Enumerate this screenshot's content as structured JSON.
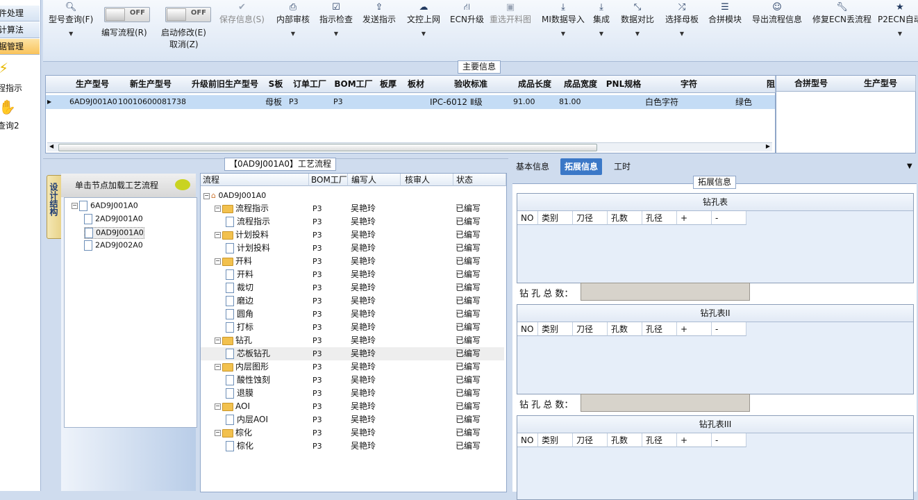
{
  "sidebar": {
    "items": [
      "件处理",
      "计算法",
      "据管理"
    ],
    "icon_labels": [
      "程指示",
      "查询2"
    ]
  },
  "toolbar": {
    "buttons": [
      {
        "label": "型号查询(F)",
        "icon": "search-icon"
      },
      {
        "label": "编写流程(R)",
        "toggle": "OFF"
      },
      {
        "label": "启动修改(E)",
        "label2": "取消(Z)",
        "toggle": "OFF"
      },
      {
        "label": "保存信息(S)",
        "icon": "check-icon"
      },
      {
        "label": "内部审核",
        "icon": "print-icon"
      },
      {
        "label": "指示检查",
        "icon": "checkbox-icon"
      },
      {
        "label": "发送指示",
        "icon": "upload-icon"
      },
      {
        "label": "文控上网",
        "icon": "cloud-upload-icon"
      },
      {
        "label": "ECN升级",
        "icon": "road-icon"
      },
      {
        "label": "重选开料图",
        "icon": "image-icon"
      },
      {
        "label": "MI数据导入",
        "icon": "download-icon"
      },
      {
        "label": "集成",
        "icon": "download-icon"
      },
      {
        "label": "数据对比",
        "icon": "compress-icon"
      },
      {
        "label": "选择母板",
        "icon": "shuffle-icon"
      },
      {
        "label": "合拼模块",
        "icon": "list-icon"
      },
      {
        "label": "导出流程信息",
        "icon": "smile-icon"
      },
      {
        "label": "修复ECN丢流程",
        "icon": "wrench-icon"
      },
      {
        "label": "P2ECN自动",
        "icon": "star-icon"
      }
    ]
  },
  "main_info": {
    "title": "主要信息",
    "columns": [
      "生产型号",
      "新生产型号",
      "升级前旧生产型号",
      "S板",
      "订单工厂",
      "BOM工厂",
      "板厚",
      "板材",
      "验收标准",
      "成品长度",
      "成品宽度",
      "PNL规格",
      "字符",
      "阻"
    ],
    "row": [
      "6AD9J001A0",
      "10010600081738",
      "",
      "母板",
      "P3",
      "P3",
      "",
      "",
      "IPC-6012 Ⅱ级",
      "91.00",
      "81.00",
      "",
      "白色字符",
      "绿色"
    ],
    "right_columns": [
      "合拼型号",
      "生产型号"
    ]
  },
  "process": {
    "title": "【0AD9J001A0】工艺流程",
    "left_tab": "设计结构",
    "node_header": "单击节点加载工艺流程",
    "nodes": [
      "6AD9J001A0",
      "2AD9J001A0",
      "0AD9J001A0",
      "2AD9J002A0"
    ],
    "columns": [
      "流程",
      "BOM工厂",
      "编写人",
      "核审人",
      "状态"
    ],
    "root": "0AD9J001A0",
    "rows": [
      {
        "name": "流程指示",
        "level": 1,
        "bom": "P3",
        "writer": "吴艳玲",
        "status": "已编写"
      },
      {
        "name": "流程指示",
        "level": 2,
        "bom": "P3",
        "writer": "吴艳玲",
        "status": "已编写"
      },
      {
        "name": "计划投料",
        "level": 1,
        "bom": "P3",
        "writer": "吴艳玲",
        "status": "已编写"
      },
      {
        "name": "计划投料",
        "level": 2,
        "bom": "P3",
        "writer": "吴艳玲",
        "status": "已编写"
      },
      {
        "name": "开料",
        "level": 1,
        "bom": "P3",
        "writer": "吴艳玲",
        "status": "已编写"
      },
      {
        "name": "开料",
        "level": 2,
        "bom": "P3",
        "writer": "吴艳玲",
        "status": "已编写"
      },
      {
        "name": "裁切",
        "level": 2,
        "bom": "P3",
        "writer": "吴艳玲",
        "status": "已编写"
      },
      {
        "name": "磨边",
        "level": 2,
        "bom": "P3",
        "writer": "吴艳玲",
        "status": "已编写"
      },
      {
        "name": "圆角",
        "level": 2,
        "bom": "P3",
        "writer": "吴艳玲",
        "status": "已编写"
      },
      {
        "name": "打标",
        "level": 2,
        "bom": "P3",
        "writer": "吴艳玲",
        "status": "已编写"
      },
      {
        "name": "钻孔",
        "level": 1,
        "bom": "P3",
        "writer": "吴艳玲",
        "status": "已编写"
      },
      {
        "name": "芯板钻孔",
        "level": 2,
        "bom": "P3",
        "writer": "吴艳玲",
        "status": "已编写",
        "selected": true
      },
      {
        "name": "内层图形",
        "level": 1,
        "bom": "P3",
        "writer": "吴艳玲",
        "status": "已编写"
      },
      {
        "name": "酸性蚀刻",
        "level": 2,
        "bom": "P3",
        "writer": "吴艳玲",
        "status": "已编写"
      },
      {
        "name": "退膜",
        "level": 2,
        "bom": "P3",
        "writer": "吴艳玲",
        "status": "已编写"
      },
      {
        "name": "AOI",
        "level": 1,
        "bom": "P3",
        "writer": "吴艳玲",
        "status": "已编写"
      },
      {
        "name": "内层AOI",
        "level": 2,
        "bom": "P3",
        "writer": "吴艳玲",
        "status": "已编写"
      },
      {
        "name": "棕化",
        "level": 1,
        "bom": "P3",
        "writer": "吴艳玲",
        "status": "已编写"
      },
      {
        "name": "棕化",
        "level": 2,
        "bom": "P3",
        "writer": "吴艳玲",
        "status": "已编写"
      }
    ]
  },
  "details": {
    "tabs": [
      "基本信息",
      "拓展信息",
      "工时"
    ],
    "group_title": "拓展信息",
    "drill_tables": [
      {
        "title": "钻孔表",
        "total_label": "钻 孔 总 数："
      },
      {
        "title": "钻孔表II",
        "total_label": "钻 孔 总 数："
      },
      {
        "title": "钻孔表III"
      }
    ],
    "drill_columns": [
      "NO",
      "类别",
      "刀径",
      "孔数",
      "孔径",
      "+",
      "-"
    ]
  },
  "colors": {
    "accent": "#3b78c7",
    "selected_row": "#c4dcf5",
    "panel_bg": "#cfdcee"
  }
}
